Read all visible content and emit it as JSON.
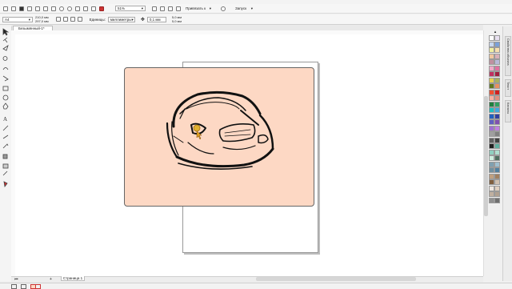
{
  "menubar": {
    "visible": true
  },
  "toolbar": {
    "zoom_value": "51%",
    "snap_label": "Привязать к",
    "launch_label": "Запуск"
  },
  "propbar": {
    "page_size": "A4",
    "width_value": "210,0 мм",
    "height_value": "297,0 мм",
    "units_label": "Единицы:",
    "units_value": "миллиметры",
    "nudge_value": "0,1 мм",
    "dup_x": "5,0 мм",
    "dup_y": "5,0 мм"
  },
  "document": {
    "tab_label": "Безымянный-1*"
  },
  "page_nav": {
    "page_label": "Страница 1"
  },
  "dockers": {
    "tab1": "Свойства объекта",
    "tab2": "Текст",
    "tab3": "Каналы"
  },
  "colors": {
    "rectangle_fill": "#fdd8c4",
    "palette": [
      "#ffffff",
      "#e8e0f0",
      "#c8d8f0",
      "#7aa0d8",
      "#f0f0a0",
      "#f8e0b0",
      "#f0c8a0",
      "#d8b0b8",
      "#c090a0",
      "#b8b8d8",
      "#f0a8c8",
      "#e070a0",
      "#c03060",
      "#a02040",
      "#e8d050",
      "#a8b060",
      "#607820",
      "#e89060",
      "#f05030",
      "#d02020",
      "#f8b0a0",
      "#e09080",
      "#208040",
      "#30a060",
      "#20c0c0",
      "#40a8e0",
      "#2060c0",
      "#3040a0",
      "#6060c0",
      "#8050b0",
      "#a070d0",
      "#c080e0",
      "#a0a0a0",
      "#808080",
      "#606060",
      "#404040",
      "#202020",
      "#60b0a0",
      "#90d0c0",
      "#b0e0d0",
      "#d0f0e0",
      "#507060",
      "#80a0b0",
      "#a0c0d0",
      "#7090a0",
      "#5080a0",
      "#c0a080",
      "#a08060",
      "#806040",
      "#d0c0b0",
      "#f0e8e0",
      "#e0d0c0",
      "#c0b0a0",
      "#b0a090",
      "#909090",
      "#707070"
    ]
  }
}
